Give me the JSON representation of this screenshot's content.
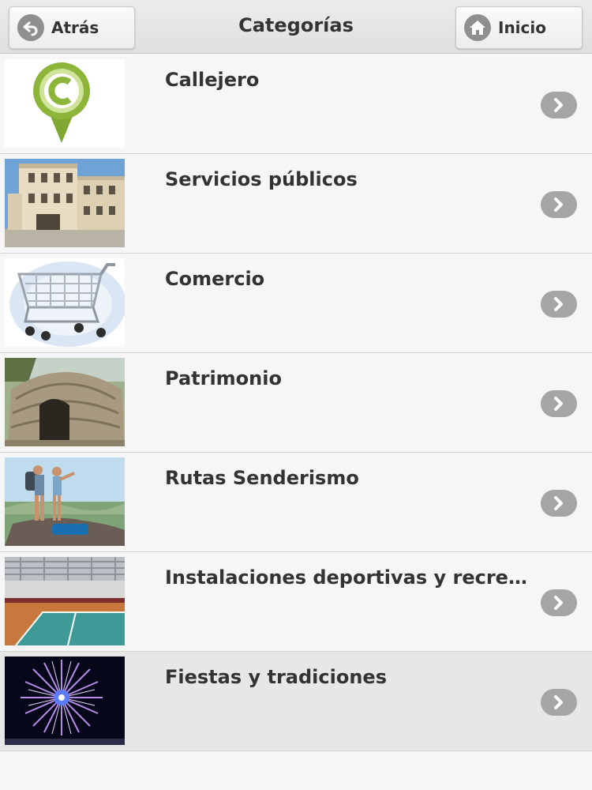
{
  "header": {
    "title": "Categorías",
    "back_label": "Atrás",
    "home_label": "Inicio"
  },
  "categories": [
    {
      "label": "Callejero",
      "icon": "map-pin-c-icon"
    },
    {
      "label": "Servicios públicos",
      "icon": "building-photo"
    },
    {
      "label": "Comercio",
      "icon": "shopping-cart-icon"
    },
    {
      "label": "Patrimonio",
      "icon": "stone-hut-photo"
    },
    {
      "label": "Rutas Senderismo",
      "icon": "hikers-photo"
    },
    {
      "label": "Instalaciones deportivas y recreativas",
      "icon": "sports-hall-photo"
    },
    {
      "label": "Fiestas y tradiciones",
      "icon": "fireworks-photo"
    }
  ],
  "colors": {
    "pin_green": "#8db53a",
    "chevron_gray": "#a5a5a5",
    "selected_row": "#e7e7e7"
  }
}
